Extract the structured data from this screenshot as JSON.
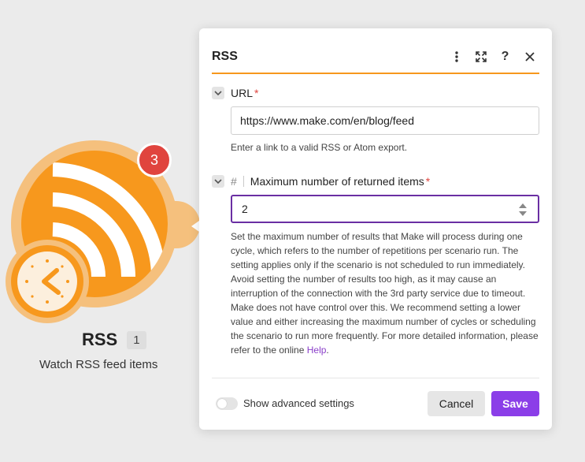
{
  "module": {
    "badge_count": "3",
    "title": "RSS",
    "instance_count": "1",
    "subtitle": "Watch RSS feed items",
    "icon": "rss-icon",
    "trigger_icon": "clock-icon"
  },
  "dialog": {
    "title": "RSS",
    "header_icons": [
      "more-vertical-icon",
      "expand-icon",
      "help-icon",
      "close-icon"
    ],
    "help_glyph": "?",
    "url_field": {
      "label": "URL",
      "required_mark": "*",
      "value": "https://www.make.com/en/blog/feed",
      "help": "Enter a link to a valid RSS or Atom export."
    },
    "max_field": {
      "type_glyph": "#",
      "label": "Maximum number of returned items",
      "required_mark": "*",
      "value": "2",
      "help": "Set the maximum number of results that Make will process during one cycle, which refers to the number of repetitions per scenario run. The setting applies only if the scenario is not scheduled to run immediately. Avoid setting the number of results too high, as it may cause an interruption of the connection with the 3rd party service due to timeout. Make does not have control over this. We recommend setting a lower value and either increasing the maximum number of cycles or scheduling the scenario to run more frequently. For more detailed information, please refer to the online ",
      "help_link": "Help",
      "help_end": "."
    },
    "advanced_toggle_label": "Show advanced settings",
    "advanced_enabled": false,
    "cancel_label": "Cancel",
    "save_label": "Save"
  },
  "colors": {
    "brand_orange": "#f7981d",
    "accent_purple": "#8b3ee8",
    "required_red": "#e0443e"
  }
}
